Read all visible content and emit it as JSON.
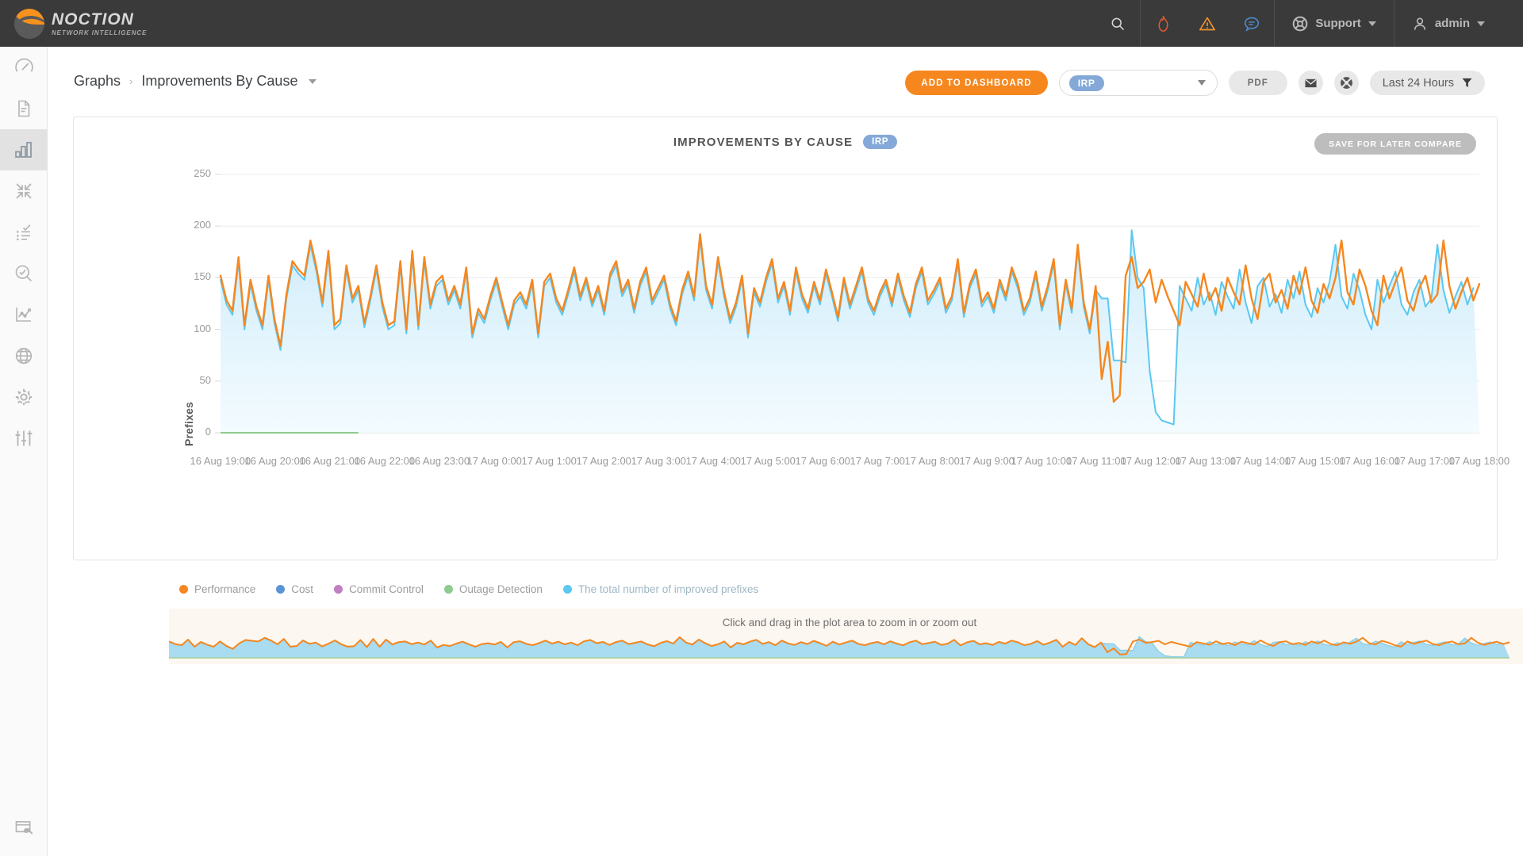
{
  "topbar": {
    "brand_name": "NOCTION",
    "brand_tagline": "NETWORK INTELLIGENCE",
    "icons": [
      "search-icon",
      "flame-icon",
      "warning-triangle-icon",
      "chat-bubble-icon",
      "lifebuoy-icon"
    ],
    "support_label": "Support",
    "user_label": "admin"
  },
  "sidebar": {
    "items": [
      {
        "icon": "speedometer-icon",
        "active": false
      },
      {
        "icon": "document-icon",
        "active": false
      },
      {
        "icon": "bar-chart-icon",
        "active": true
      },
      {
        "icon": "collapse-arrows-icon",
        "active": false
      },
      {
        "icon": "checklist-icon",
        "active": false
      },
      {
        "icon": "search-check-icon",
        "active": false
      },
      {
        "icon": "line-chart-icon",
        "active": false
      },
      {
        "icon": "globe-icon",
        "active": false
      },
      {
        "icon": "gear-icon",
        "active": false
      },
      {
        "icon": "sliders-icon",
        "active": false
      }
    ],
    "bottom_item": {
      "icon": "window-wrench-icon"
    }
  },
  "breadcrumb": {
    "root": "Graphs",
    "separator": "›",
    "current": "Improvements By Cause"
  },
  "toolbar": {
    "add_to_dashboard": "ADD TO DASHBOARD",
    "selected_policy": "IRP",
    "pdf_label": "PDF",
    "mail_icon": "envelope-icon",
    "help_icon": "lifebuoy-icon",
    "time_range": "Last 24 Hours",
    "filter_icon": "funnel-icon"
  },
  "card": {
    "title": "IMPROVEMENTS BY CAUSE",
    "title_badge": "IRP",
    "save_compare": "SAVE FOR LATER COMPARE",
    "navigator_hint": "Click and drag in the plot area to zoom in or zoom out"
  },
  "colors": {
    "performance": "#f6871f",
    "cost": "#5b93d6",
    "commit_control": "#c07fc0",
    "outage_detection": "#8fca8f",
    "total_improved": "#5bc8f0",
    "accent_orange": "#f6871f",
    "badge_blue": "#84a9d8",
    "topbar_bg": "#3a3a3a"
  },
  "chart_data": {
    "type": "line",
    "title": "IMPROVEMENTS BY CAUSE",
    "xlabel": "",
    "ylabel": "Prefixes",
    "ylim": [
      0,
      250
    ],
    "yticks": [
      0,
      50,
      100,
      150,
      200,
      250
    ],
    "grid": true,
    "legend_position": "bottom-left",
    "xtick_labels": [
      "16 Aug 19:00",
      "16 Aug 20:00",
      "16 Aug 21:00",
      "16 Aug 22:00",
      "16 Aug 23:00",
      "17 Aug 0:00",
      "17 Aug 1:00",
      "17 Aug 2:00",
      "17 Aug 3:00",
      "17 Aug 4:00",
      "17 Aug 5:00",
      "17 Aug 6:00",
      "17 Aug 7:00",
      "17 Aug 8:00",
      "17 Aug 9:00",
      "17 Aug 10:00",
      "17 Aug 11:00",
      "17 Aug 12:00",
      "17 Aug 13:00",
      "17 Aug 14:00",
      "17 Aug 15:00",
      "17 Aug 16:00",
      "17 Aug 17:00",
      "17 Aug 18:00"
    ],
    "series": [
      {
        "name": "Performance",
        "color": "#f6871f",
        "values": [
          152,
          128,
          118,
          170,
          104,
          148,
          122,
          104,
          152,
          110,
          84,
          134,
          166,
          158,
          152,
          186,
          160,
          126,
          176,
          104,
          110,
          162,
          130,
          142,
          106,
          132,
          162,
          126,
          104,
          108,
          166,
          100,
          176,
          104,
          170,
          124,
          146,
          152,
          128,
          142,
          124,
          160,
          96,
          120,
          110,
          132,
          150,
          126,
          104,
          128,
          136,
          124,
          148,
          96,
          146,
          154,
          130,
          118,
          138,
          160,
          132,
          150,
          126,
          142,
          118,
          154,
          166,
          136,
          148,
          120,
          146,
          160,
          128,
          140,
          152,
          124,
          108,
          138,
          156,
          132,
          192,
          142,
          124,
          170,
          136,
          110,
          126,
          152,
          96,
          140,
          126,
          150,
          168,
          130,
          146,
          118,
          160,
          134,
          120,
          146,
          128,
          158,
          136,
          112,
          150,
          124,
          142,
          160,
          130,
          118,
          136,
          148,
          126,
          154,
          132,
          116,
          144,
          160,
          128,
          138,
          150,
          120,
          132,
          168,
          116,
          144,
          158,
          126,
          136,
          120,
          148,
          132,
          160,
          144,
          118,
          130,
          156,
          122,
          142,
          168,
          104,
          148,
          120,
          182,
          126,
          100,
          142,
          52,
          88,
          30,
          36,
          152,
          170,
          140,
          146,
          158,
          126,
          148,
          132,
          118,
          104,
          146,
          134,
          122,
          154,
          128,
          140,
          118,
          150,
          136,
          124,
          162,
          130,
          110,
          146,
          154,
          126,
          138,
          120,
          152,
          134,
          160,
          128,
          116,
          144,
          130,
          150,
          186,
          136,
          124,
          158,
          142,
          118,
          104,
          152,
          130,
          146,
          160,
          128,
          118,
          140,
          152,
          126,
          134,
          186,
          142,
          120,
          136,
          150,
          128,
          144
        ]
      },
      {
        "name": "Cost",
        "color": "#5b93d6",
        "values": []
      },
      {
        "name": "Commit Control",
        "color": "#c07fc0",
        "values": []
      },
      {
        "name": "Outage Detection",
        "color": "#8fca8f",
        "values": [
          0,
          0,
          0,
          0,
          0,
          0,
          0,
          0,
          0,
          0,
          0,
          0,
          0,
          0,
          0,
          0,
          0,
          0,
          0,
          0,
          0,
          0,
          0,
          0
        ]
      },
      {
        "name": "The total number of improved prefixes",
        "color": "#5bc8f0",
        "values": [
          148,
          124,
          114,
          166,
          100,
          144,
          118,
          100,
          148,
          106,
          80,
          130,
          162,
          154,
          148,
          182,
          156,
          122,
          172,
          100,
          106,
          158,
          126,
          138,
          102,
          128,
          158,
          122,
          100,
          104,
          162,
          96,
          172,
          100,
          166,
          120,
          142,
          148,
          124,
          138,
          120,
          156,
          92,
          116,
          106,
          128,
          146,
          122,
          100,
          124,
          132,
          120,
          144,
          92,
          142,
          150,
          126,
          114,
          134,
          156,
          128,
          146,
          122,
          138,
          114,
          150,
          162,
          132,
          144,
          116,
          142,
          156,
          124,
          136,
          148,
          120,
          104,
          134,
          152,
          128,
          188,
          138,
          120,
          166,
          132,
          106,
          122,
          148,
          92,
          136,
          122,
          146,
          164,
          126,
          142,
          114,
          156,
          130,
          116,
          142,
          124,
          154,
          132,
          108,
          146,
          120,
          138,
          156,
          126,
          114,
          132,
          144,
          122,
          150,
          128,
          112,
          140,
          156,
          124,
          134,
          146,
          116,
          128,
          164,
          112,
          140,
          154,
          122,
          132,
          116,
          144,
          128,
          156,
          140,
          114,
          126,
          152,
          118,
          138,
          164,
          100,
          144,
          116,
          178,
          122,
          96,
          138,
          130,
          130,
          70,
          70,
          68,
          196,
          150,
          140,
          60,
          20,
          12,
          10,
          8,
          142,
          130,
          118,
          150,
          124,
          136,
          114,
          146,
          132,
          120,
          158,
          126,
          106,
          142,
          150,
          122,
          134,
          116,
          148,
          130,
          156,
          124,
          112,
          140,
          126,
          146,
          182,
          132,
          120,
          154,
          138,
          114,
          100,
          148,
          126,
          142,
          156,
          124,
          114,
          136,
          148,
          122,
          130,
          182,
          138,
          116,
          132,
          146,
          124,
          140
        ]
      }
    ],
    "legend": [
      {
        "label": "Performance",
        "color": "#f6871f"
      },
      {
        "label": "Cost",
        "color": "#5b93d6"
      },
      {
        "label": "Commit Control",
        "color": "#c07fc0"
      },
      {
        "label": "Outage Detection",
        "color": "#8fca8f"
      },
      {
        "label": "The total number of improved prefixes",
        "color": "#5bc8f0"
      }
    ]
  }
}
